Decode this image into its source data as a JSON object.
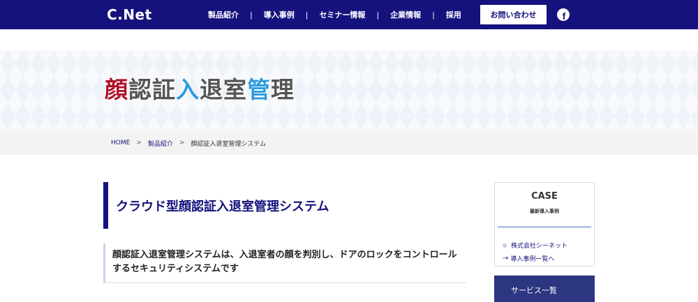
{
  "header": {
    "logo": "C.Net",
    "nav": [
      "製品紹介",
      "導入事例",
      "セミナー情報",
      "企業情報",
      "採用"
    ],
    "nav_separator": "|",
    "contact_button": "お問い合わせ",
    "social_icon": "facebook-icon",
    "social_glyph": "f"
  },
  "hero": {
    "title_parts": [
      "顔",
      "認証",
      "入",
      "退室",
      "管",
      "理"
    ]
  },
  "breadcrumb": {
    "home": "HOME",
    "products": "製品紹介",
    "current": "顔認証入退室管理システム",
    "separator": ">"
  },
  "main": {
    "heading": "クラウド型顔認証入退室管理システム",
    "lead_line1": "顔認証入退室管理システムは、入退室者の顔を判別し、ドアのロックをコントロール",
    "lead_line2": "するセキュリティシステムです"
  },
  "sidebar": {
    "case_title": "CASE",
    "case_subtitle": "最新導入事例",
    "case_item": "株式会社シーネット",
    "case_link_arrow": "→",
    "case_link": "導入事例一覧へ",
    "service_title": "サービス一覧"
  },
  "colors": {
    "navy": "#15127d",
    "accent_red": "#b1132a",
    "accent_blue": "#2f9be0",
    "title_gray": "#555555",
    "service_bg": "#2d3680"
  }
}
